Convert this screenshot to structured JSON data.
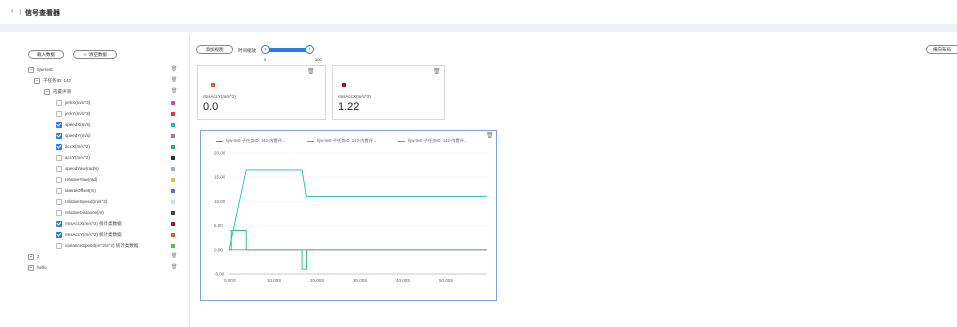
{
  "header": {
    "back_icon": "chevron-left-icon",
    "title": "信号查看器"
  },
  "sidebar": {
    "load_label": "载入数据",
    "clear_label": "清空数据",
    "clear_icon": "trash-icon",
    "items": [
      {
        "label": "hjw-test",
        "level": 0,
        "expander": "−"
      },
      {
        "label": "子任务ID: 142",
        "level": 1,
        "expander": "−"
      },
      {
        "label": "内置评测",
        "level": 2,
        "expander": "−"
      },
      {
        "label": "jerkX(m/s^3)",
        "level": 3,
        "checked": false,
        "color": "#c94fbf"
      },
      {
        "label": "jerkY(m/s^3)",
        "level": 3,
        "checked": false,
        "color": "#e0315b"
      },
      {
        "label": "speedX(m/s)",
        "level": 3,
        "checked": true,
        "color": "#1fbfbf"
      },
      {
        "label": "speedY(m/s)",
        "level": 3,
        "checked": true,
        "color": "#9a7f9d"
      },
      {
        "label": "accX(m/s^2)",
        "level": 3,
        "checked": true,
        "color": "#22b573"
      },
      {
        "label": "accY(m/s^2)",
        "level": 3,
        "checked": false,
        "color": "#333333"
      },
      {
        "label": "speedYaw(rad/s)",
        "level": 3,
        "checked": false,
        "color": "#8fb1e8"
      },
      {
        "label": "relativeYaw(rad)",
        "level": 3,
        "checked": false,
        "color": "#d8c23a"
      },
      {
        "label": "lateralOffset(m)",
        "level": 3,
        "checked": false,
        "color": "#5273c9"
      },
      {
        "label": "relativeSpeed(m/s^2)",
        "level": 3,
        "checked": false,
        "color": "#b8ecec"
      },
      {
        "label": "relativeDistance(m)",
        "level": 3,
        "checked": false,
        "color": "#444444"
      },
      {
        "label": "rmsAccX(m/s^2)  统计类数据",
        "level": 3,
        "checked": true,
        "color": "#b5121b"
      },
      {
        "label": "rmsAccY(m/s^2)  统计类数据",
        "level": 3,
        "checked": true,
        "color": "#e0632b"
      },
      {
        "label": "varianceSpeed(m^2/s^2)  统计类数据",
        "level": 3,
        "checked": false,
        "color": "#59c44a"
      },
      {
        "label": "2",
        "level": 0,
        "expander": "+"
      },
      {
        "label": "hello",
        "level": 0,
        "expander": "+"
      }
    ]
  },
  "toolbar": {
    "add_view_label": "添加视图",
    "time_scale_label": "时间缩放",
    "slider_min": "0",
    "slider_max": "100",
    "slider_knob_left": "II",
    "slider_knob_right": "II",
    "slider_range": [
      0,
      100
    ],
    "layout_button_label": "横向布局"
  },
  "cards": [
    {
      "label": "rmsAccY(m/s^2)",
      "value": "0.0",
      "color": "#e0632b"
    },
    {
      "label": "rmsAccX(m/s^2)",
      "value": "1.22",
      "color": "#b5121b"
    }
  ],
  "chart_legend": [
    {
      "label": "hjw-test-子任务ID: 142-内置评...",
      "color": "#22b573"
    },
    {
      "label": "hjw-test-子任务ID: 142-内置评...",
      "color": "#9a7f9d"
    },
    {
      "label": "hjw-test-子任务ID: 142-内置评...",
      "color": "#1fbfbf"
    }
  ],
  "chart_data": {
    "type": "line",
    "xlabel": "",
    "ylabel": "",
    "xlim": [
      0,
      60
    ],
    "ylim": [
      -5,
      20
    ],
    "x_ticks": [
      "0.00S",
      "10.00S",
      "20.00S",
      "30.00S",
      "40.00S",
      "50.00S"
    ],
    "x_tick_values": [
      0,
      10,
      20,
      30,
      40,
      50
    ],
    "y_ticks": [
      "20.00",
      "15.00",
      "10.00",
      "5.00",
      "0.00",
      "-5.00"
    ],
    "y_tick_values": [
      20,
      15,
      10,
      5,
      0,
      -5
    ],
    "series": [
      {
        "color": "#22b573",
        "x": [
          0,
          0.5,
          0.5,
          4,
          4,
          17,
          17,
          18,
          18,
          60
        ],
        "y": [
          0,
          0,
          4,
          4,
          0,
          0,
          -4,
          -4,
          0,
          0
        ]
      },
      {
        "color": "#9a7f9d",
        "x": [
          0,
          60
        ],
        "y": [
          0,
          0
        ]
      },
      {
        "color": "#1fbfbf",
        "x": [
          0,
          4,
          17,
          18,
          60
        ],
        "y": [
          0,
          16.5,
          16.5,
          11,
          11
        ]
      }
    ]
  }
}
